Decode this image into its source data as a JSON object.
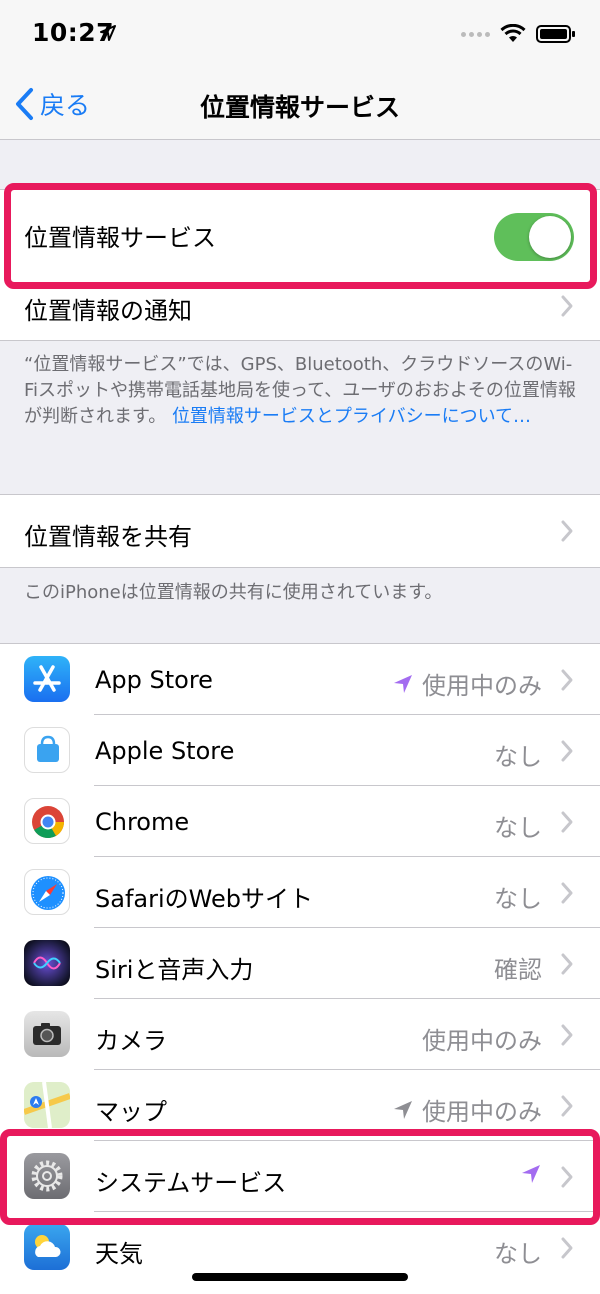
{
  "status_bar": {
    "time": "10:27"
  },
  "nav": {
    "back_label": "戻る",
    "title": "位置情報サービス"
  },
  "location_services": {
    "label": "位置情報サービス",
    "enabled": true
  },
  "notifications": {
    "label": "位置情報の通知"
  },
  "description": {
    "text": "“位置情報サービス”では、GPS、Bluetooth、クラウドソースのWi-Fiスポットや携帯電話基地局を使って、ユーザのおおよその位置情報が判断されます。",
    "link": "位置情報サービスとプライバシーについて…"
  },
  "share": {
    "label": "位置情報を共有"
  },
  "share_footer": "このiPhoneは位置情報の共有に使用されています。",
  "apps": [
    {
      "name": "App Store",
      "value": "使用中のみ",
      "icon": "app-store-icon",
      "arrow": "purple"
    },
    {
      "name": "Apple Store",
      "value": "なし",
      "icon": "apple-store-icon",
      "arrow": ""
    },
    {
      "name": "Chrome",
      "value": "なし",
      "icon": "chrome-icon",
      "arrow": ""
    },
    {
      "name": "SafariのWebサイト",
      "value": "なし",
      "icon": "safari-icon",
      "arrow": ""
    },
    {
      "name": "Siriと音声入力",
      "value": "確認",
      "icon": "siri-icon",
      "arrow": ""
    },
    {
      "name": "カメラ",
      "value": "使用中のみ",
      "icon": "camera-icon",
      "arrow": ""
    },
    {
      "name": "マップ",
      "value": "使用中のみ",
      "icon": "maps-icon",
      "arrow": "gray"
    },
    {
      "name": "システムサービス",
      "value": "",
      "icon": "settings-gear-icon",
      "arrow": "purple"
    },
    {
      "name": "天気",
      "value": "なし",
      "icon": "weather-icon",
      "arrow": ""
    }
  ],
  "colors": {
    "accent": "#1a7cf5",
    "toggle_on": "#5fbf5a",
    "highlight": "#e8195c",
    "purple_arrow": "#a36cf0"
  }
}
